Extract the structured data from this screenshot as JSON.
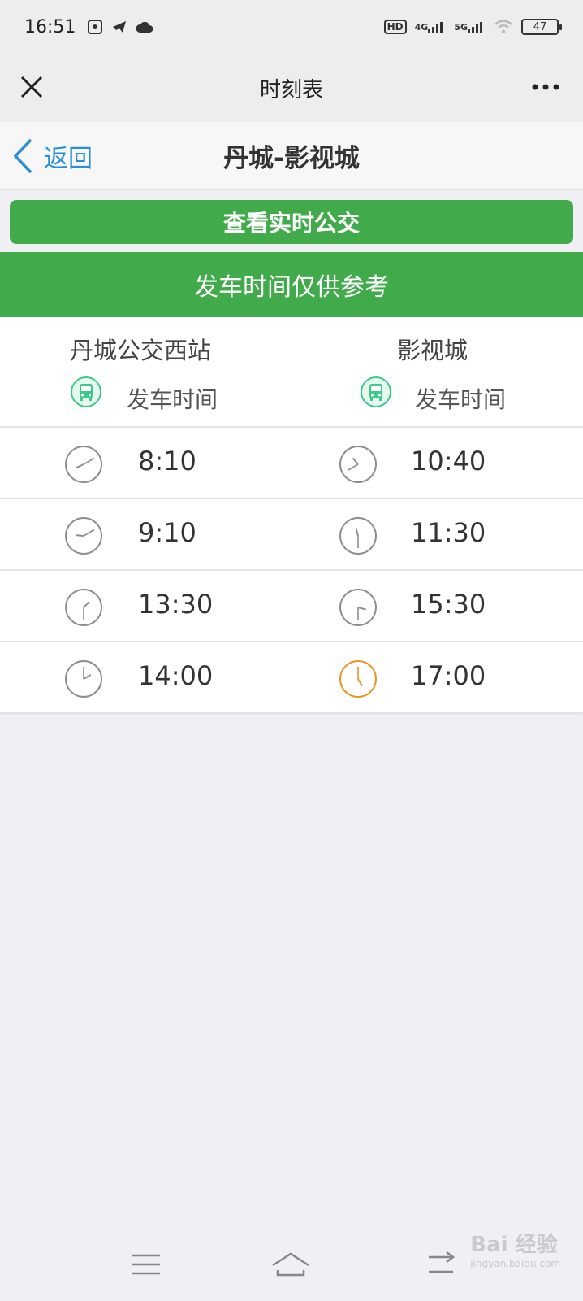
{
  "status_bar": {
    "time": "16:51",
    "network": [
      "HD",
      "4G",
      "5G"
    ],
    "battery": "47"
  },
  "title_bar": {
    "title": "时刻表",
    "close_icon": "close-icon",
    "more_icon": "more-icon"
  },
  "nav": {
    "back_label": "返回",
    "route_title": "丹城-影视城"
  },
  "realtime_button": "查看实时公交",
  "notice": "发车时间仅供参考",
  "timetable": {
    "columns": [
      {
        "station": "丹城公交西站",
        "departure_label": "发车时间"
      },
      {
        "station": "影视城",
        "departure_label": "发车时间"
      }
    ],
    "rows": [
      {
        "left": "8:10",
        "right": "10:40"
      },
      {
        "left": "9:10",
        "right": "11:30"
      },
      {
        "left": "13:30",
        "right": "15:30"
      },
      {
        "left": "14:00",
        "right": "17:00"
      }
    ],
    "colors": {
      "clock": "#8e8e8e",
      "highlight_clock": "#e8952a",
      "bus_icon": "#3dc98a"
    }
  },
  "watermark": {
    "brand": "Bai 经验",
    "url": "jingyan.baidu.com"
  }
}
